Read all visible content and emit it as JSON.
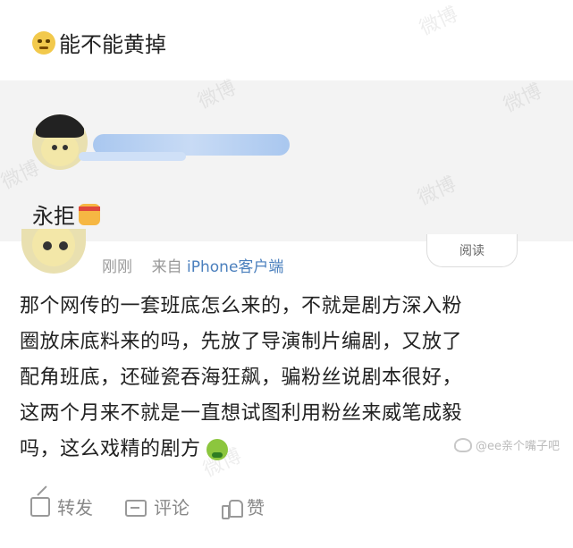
{
  "watermark": "微博",
  "quote1": {
    "text": "能不能黄掉",
    "emoji": "thinking-face-icon"
  },
  "repost": {
    "text": "永拒",
    "emoji": "yelling-face-icon"
  },
  "post": {
    "read_label": "阅读",
    "time": "刚刚",
    "from_prefix": "来自",
    "source": "iPhone客户端",
    "lines": [
      "那个网传的一套班底怎么来的，不就是剧方深入粉",
      "圈放床底料来的吗，先放了导演制片编剧，又放了",
      "配角班底，还碰瓷吞海狂飙，骗粉丝说剧本很好，",
      "这两个月来不就是一直想试图利用粉丝来威笔成毅",
      "吗，这么戏精的剧方"
    ],
    "end_emoji": "nauseated-face-icon"
  },
  "actions": {
    "repost": "转发",
    "comment": "评论",
    "like": "赞"
  },
  "credit": "@ee亲个嘴子吧"
}
